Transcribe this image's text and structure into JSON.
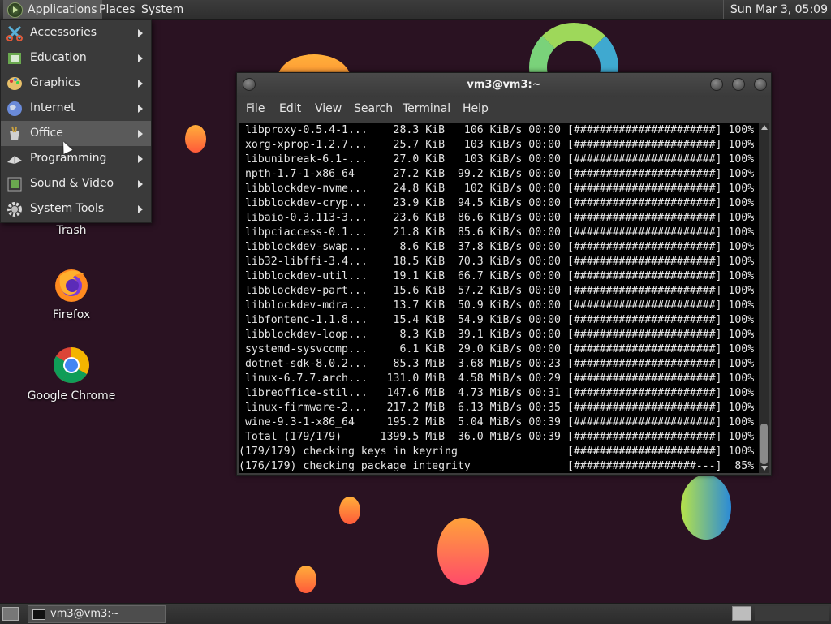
{
  "top_panel": {
    "applications": "Applications",
    "places": "Places",
    "system": "System",
    "clock": "Sun Mar  3, 05:09"
  },
  "applications_menu": {
    "items": [
      {
        "label": "Accessories",
        "icon": "scissors-icon"
      },
      {
        "label": "Education",
        "icon": "education-icon"
      },
      {
        "label": "Graphics",
        "icon": "palette-icon"
      },
      {
        "label": "Internet",
        "icon": "globe-icon"
      },
      {
        "label": "Office",
        "icon": "office-icon"
      },
      {
        "label": "Programming",
        "icon": "programming-icon"
      },
      {
        "label": "Sound & Video",
        "icon": "film-icon"
      },
      {
        "label": "System Tools",
        "icon": "gear-icon"
      }
    ],
    "hovered": "Office"
  },
  "desktop": {
    "icons": [
      {
        "label": "Trash"
      },
      {
        "label": "Firefox"
      },
      {
        "label": "Google Chrome"
      }
    ]
  },
  "terminal": {
    "title": "vm3@vm3:~",
    "menu": [
      "File",
      "Edit",
      "View",
      "Search",
      "Terminal",
      "Help"
    ],
    "lines": [
      " libproxy-0.5.4-1...    28.3 KiB   106 KiB/s 00:00 [######################] 100%",
      " xorg-xprop-1.2.7...    25.7 KiB   103 KiB/s 00:00 [######################] 100%",
      " libunibreak-6.1-...    27.0 KiB   103 KiB/s 00:00 [######################] 100%",
      " npth-1.7-1-x86_64      27.2 KiB  99.2 KiB/s 00:00 [######################] 100%",
      " libblockdev-nvme...    24.8 KiB   102 KiB/s 00:00 [######################] 100%",
      " libblockdev-cryp...    23.9 KiB  94.5 KiB/s 00:00 [######################] 100%",
      " libaio-0.3.113-3...    23.6 KiB  86.6 KiB/s 00:00 [######################] 100%",
      " libpciaccess-0.1...    21.8 KiB  85.6 KiB/s 00:00 [######################] 100%",
      " libblockdev-swap...     8.6 KiB  37.8 KiB/s 00:00 [######################] 100%",
      " lib32-libffi-3.4...    18.5 KiB  70.3 KiB/s 00:00 [######################] 100%",
      " libblockdev-util...    19.1 KiB  66.7 KiB/s 00:00 [######################] 100%",
      " libblockdev-part...    15.6 KiB  57.2 KiB/s 00:00 [######################] 100%",
      " libblockdev-mdra...    13.7 KiB  50.9 KiB/s 00:00 [######################] 100%",
      " libfontenc-1.1.8...    15.4 KiB  54.9 KiB/s 00:00 [######################] 100%",
      " libblockdev-loop...     8.3 KiB  39.1 KiB/s 00:00 [######################] 100%",
      " systemd-sysvcomp...     6.1 KiB  29.0 KiB/s 00:00 [######################] 100%",
      " dotnet-sdk-8.0.2...    85.3 MiB  3.68 MiB/s 00:23 [######################] 100%",
      " linux-6.7.7.arch...   131.0 MiB  4.58 MiB/s 00:29 [######################] 100%",
      " libreoffice-stil...   147.6 MiB  4.73 MiB/s 00:31 [######################] 100%",
      " linux-firmware-2...   217.2 MiB  6.13 MiB/s 00:35 [######################] 100%",
      " wine-9.3-1-x86_64     195.2 MiB  5.04 MiB/s 00:39 [######################] 100%",
      " Total (179/179)      1399.5 MiB  36.0 MiB/s 00:39 [######################] 100%",
      "(179/179) checking keys in keyring                 [######################] 100%",
      "(176/179) checking package integrity               [###################---]  85%"
    ]
  },
  "taskbar": {
    "task_label": "vm3@vm3:~"
  }
}
